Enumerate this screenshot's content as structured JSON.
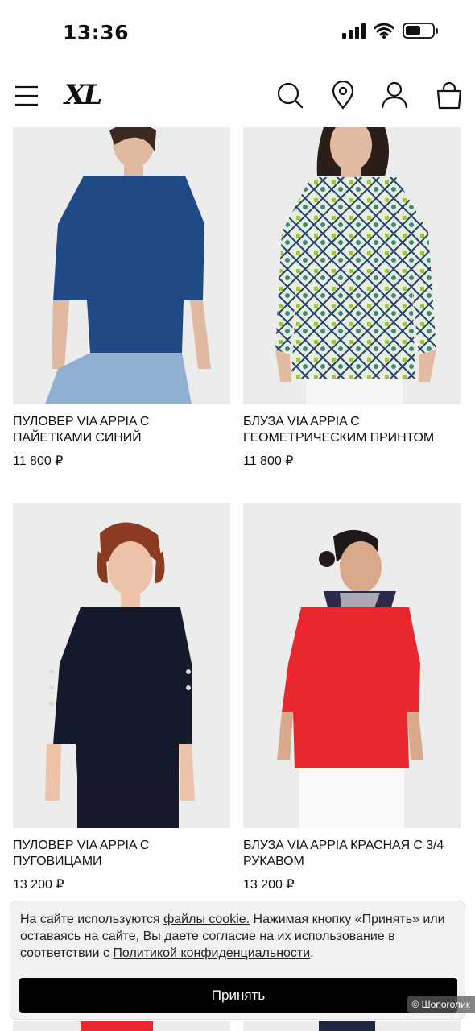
{
  "status_bar": {
    "time": "13:36"
  },
  "header": {
    "logo": "XL"
  },
  "products": [
    {
      "title": "ПУЛОВЕР VIA APPIA С ПАЙЕТКАМИ СИНИЙ",
      "price": "11 800 ₽",
      "garment_color": "#1f4a86"
    },
    {
      "title": "БЛУЗА VIA APPIA С ГЕОМЕТРИЧЕСКИМ ПРИНТОМ",
      "price": "11 800 ₽",
      "garment_color": "#c9d8c8"
    },
    {
      "title": "ПУЛОВЕР VIA APPIA С ПУГОВИЦАМИ",
      "price": "13 200 ₽",
      "garment_color": "#141a2c"
    },
    {
      "title": "БЛУЗА VIA APPIA КРАСНАЯ С 3/4 РУКАВОМ",
      "price": "13 200 ₽",
      "garment_color": "#e8272e"
    }
  ],
  "cookie": {
    "text_1": "На сайте используются ",
    "link_1": "файлы cookie.",
    "text_2": " Нажимая кнопку «Принять» или оставаясь на сайте, Вы даете согласие на их использование в соответствии с ",
    "link_2": "Политикой конфиденциальности",
    "text_3": ".",
    "accept_label": "Принять"
  },
  "watermark": "© Шопоголик"
}
